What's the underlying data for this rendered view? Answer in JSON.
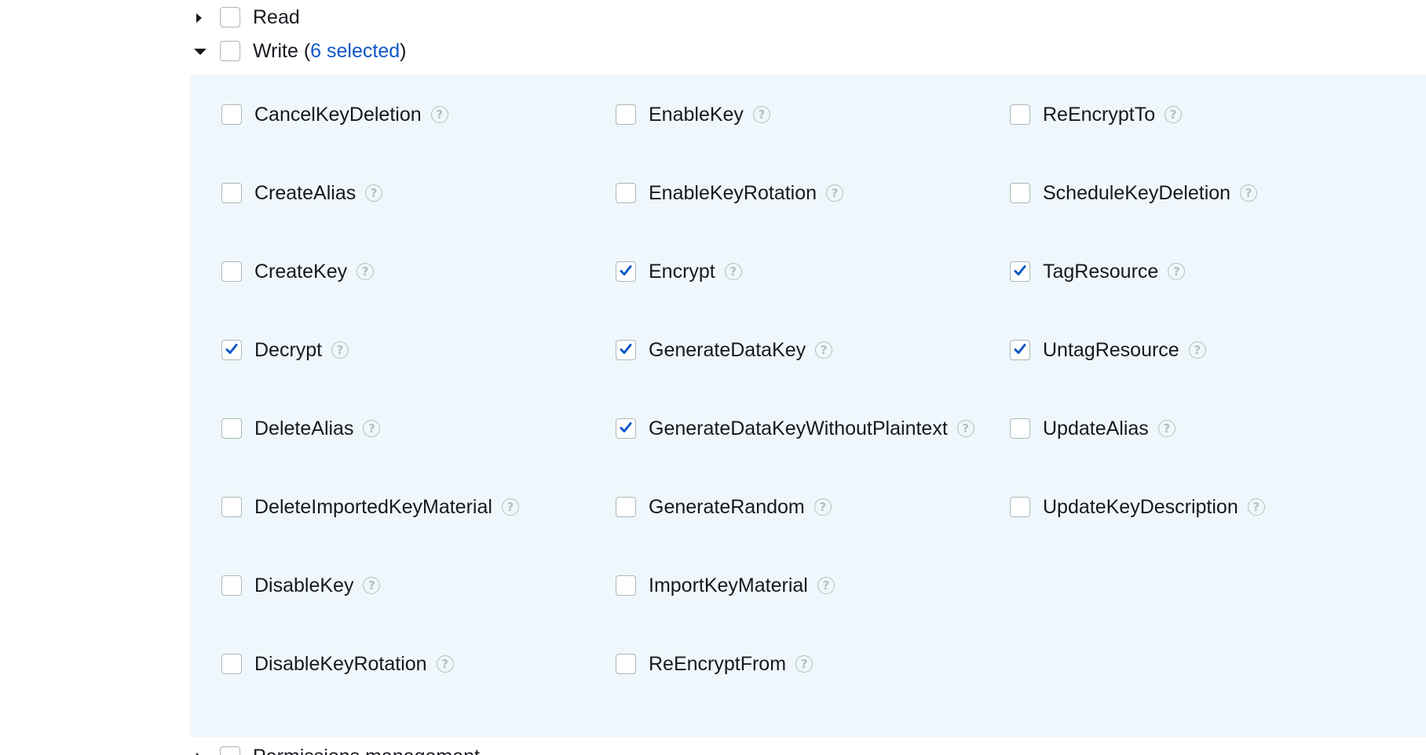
{
  "groups": {
    "read": {
      "label": "Read"
    },
    "write": {
      "label_prefix": "Write (",
      "selected_text": "6 selected",
      "label_suffix": ")"
    },
    "next": {
      "label": "Permissions management"
    }
  },
  "icons": {
    "help": "?"
  },
  "colors": {
    "panel_bg": "#eff7fd",
    "link": "#0e58c8",
    "check": "#0e58c8"
  },
  "write_actions": [
    {
      "label": "CancelKeyDeletion",
      "checked": false
    },
    {
      "label": "EnableKey",
      "checked": false
    },
    {
      "label": "ReEncryptTo",
      "checked": false
    },
    {
      "label": "CreateAlias",
      "checked": false
    },
    {
      "label": "EnableKeyRotation",
      "checked": false
    },
    {
      "label": "ScheduleKeyDeletion",
      "checked": false
    },
    {
      "label": "CreateKey",
      "checked": false
    },
    {
      "label": "Encrypt",
      "checked": true
    },
    {
      "label": "TagResource",
      "checked": true
    },
    {
      "label": "Decrypt",
      "checked": true
    },
    {
      "label": "GenerateDataKey",
      "checked": true
    },
    {
      "label": "UntagResource",
      "checked": true
    },
    {
      "label": "DeleteAlias",
      "checked": false
    },
    {
      "label": "GenerateDataKeyWithoutPlaintext",
      "checked": true
    },
    {
      "label": "UpdateAlias",
      "checked": false
    },
    {
      "label": "DeleteImportedKeyMaterial",
      "checked": false
    },
    {
      "label": "GenerateRandom",
      "checked": false
    },
    {
      "label": "UpdateKeyDescription",
      "checked": false
    },
    {
      "label": "DisableKey",
      "checked": false
    },
    {
      "label": "ImportKeyMaterial",
      "checked": false
    },
    null,
    {
      "label": "DisableKeyRotation",
      "checked": false
    },
    {
      "label": "ReEncryptFrom",
      "checked": false
    },
    null
  ]
}
